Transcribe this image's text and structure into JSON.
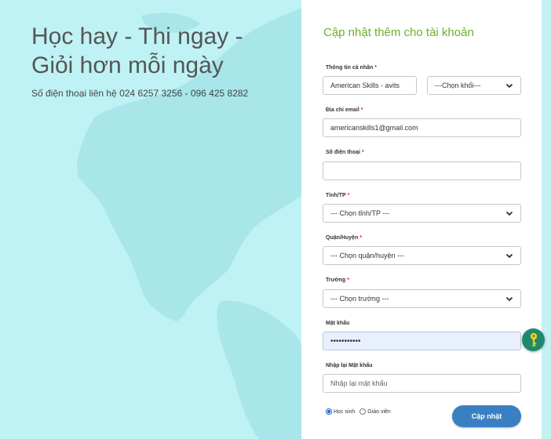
{
  "hero": {
    "title": "Học hay - Thi ngay - Giỏi hơn mỗi ngày",
    "phone": "Số điện thoại liên hệ 024 6257 3256 - 096 425 8282"
  },
  "form": {
    "title": "Cập nhật thêm cho tài khoản",
    "personal_label": "Thông tin cá nhân",
    "name_value": "American Skills - avits",
    "grade_select": "---Chọn khối---",
    "email_label": "Địa chỉ email",
    "email_value": "americanskills1@gmail.com",
    "phone_label": "Số điện thoại",
    "phone_value": "",
    "province_label": "Tỉnh/TP",
    "province_select": "--- Chọn tỉnh/TP ---",
    "district_label": "Quận/Huyện",
    "district_select": "--- Chọn quận/huyện ---",
    "school_label": "Trường",
    "school_select": "--- Chọn trường ---",
    "password_label": "Mật khẩu",
    "password_value": "•••••••••••",
    "confirm_label": "Nhập lại Mật khẩu",
    "confirm_placeholder": "Nhập lại mật khẩu",
    "required_mark": "*",
    "role_student": "Học sinh",
    "role_teacher": "Giáo viên",
    "role_selected": "student",
    "submit_label": "Cập nhật"
  },
  "colors": {
    "accent_green": "#6fae2d",
    "button_blue": "#3a7fc2",
    "required_red": "#d9251c",
    "map_bg": "#bff2f5"
  },
  "icons": {
    "dropdown": "chevron-down-icon",
    "password_manager": "key-icon"
  }
}
